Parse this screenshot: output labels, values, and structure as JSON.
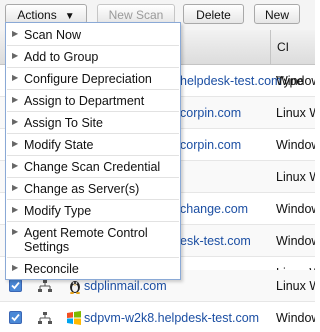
{
  "toolbar": {
    "actions_label": "Actions",
    "new_scan_label": "New Scan",
    "delete_label": "Delete",
    "new_label": "New"
  },
  "table": {
    "ci_type_header": "CI Type",
    "rows": [
      {
        "name": "helpdesk-test.com",
        "type": "Window"
      },
      {
        "name": "corpin.com",
        "type": "Linux W"
      },
      {
        "name": "corpin.com",
        "type": "Window"
      },
      {
        "name": "",
        "type": "Linux W"
      },
      {
        "name": "change.com",
        "type": "Window"
      },
      {
        "name": "esk-test.com",
        "type": "Window"
      },
      {
        "name": "",
        "type": "Linux W"
      },
      {
        "name": "sdplinmail.com",
        "type": "Linux W"
      },
      {
        "name": "sdpvm-w2k8.helpdesk-test.com",
        "type": "Window"
      }
    ]
  },
  "menu": {
    "items": [
      "Scan Now",
      "Add to Group",
      "Configure Depreciation",
      "Assign to Department",
      "Assign To Site",
      "Modify State",
      "Change Scan Credential",
      "Change as Server(s)",
      "Modify Type",
      "Agent Remote Control Settings",
      "Reconcile"
    ]
  },
  "colors": {
    "link": "#1c4fa3",
    "menu_border": "#8aa9d6",
    "checkbox": "#4a88d6"
  },
  "icons": {
    "menu_arrow": "triangle-right-icon",
    "network": "network-icon",
    "linux": "linux-penguin-icon",
    "windows": "windows-logo-icon"
  }
}
